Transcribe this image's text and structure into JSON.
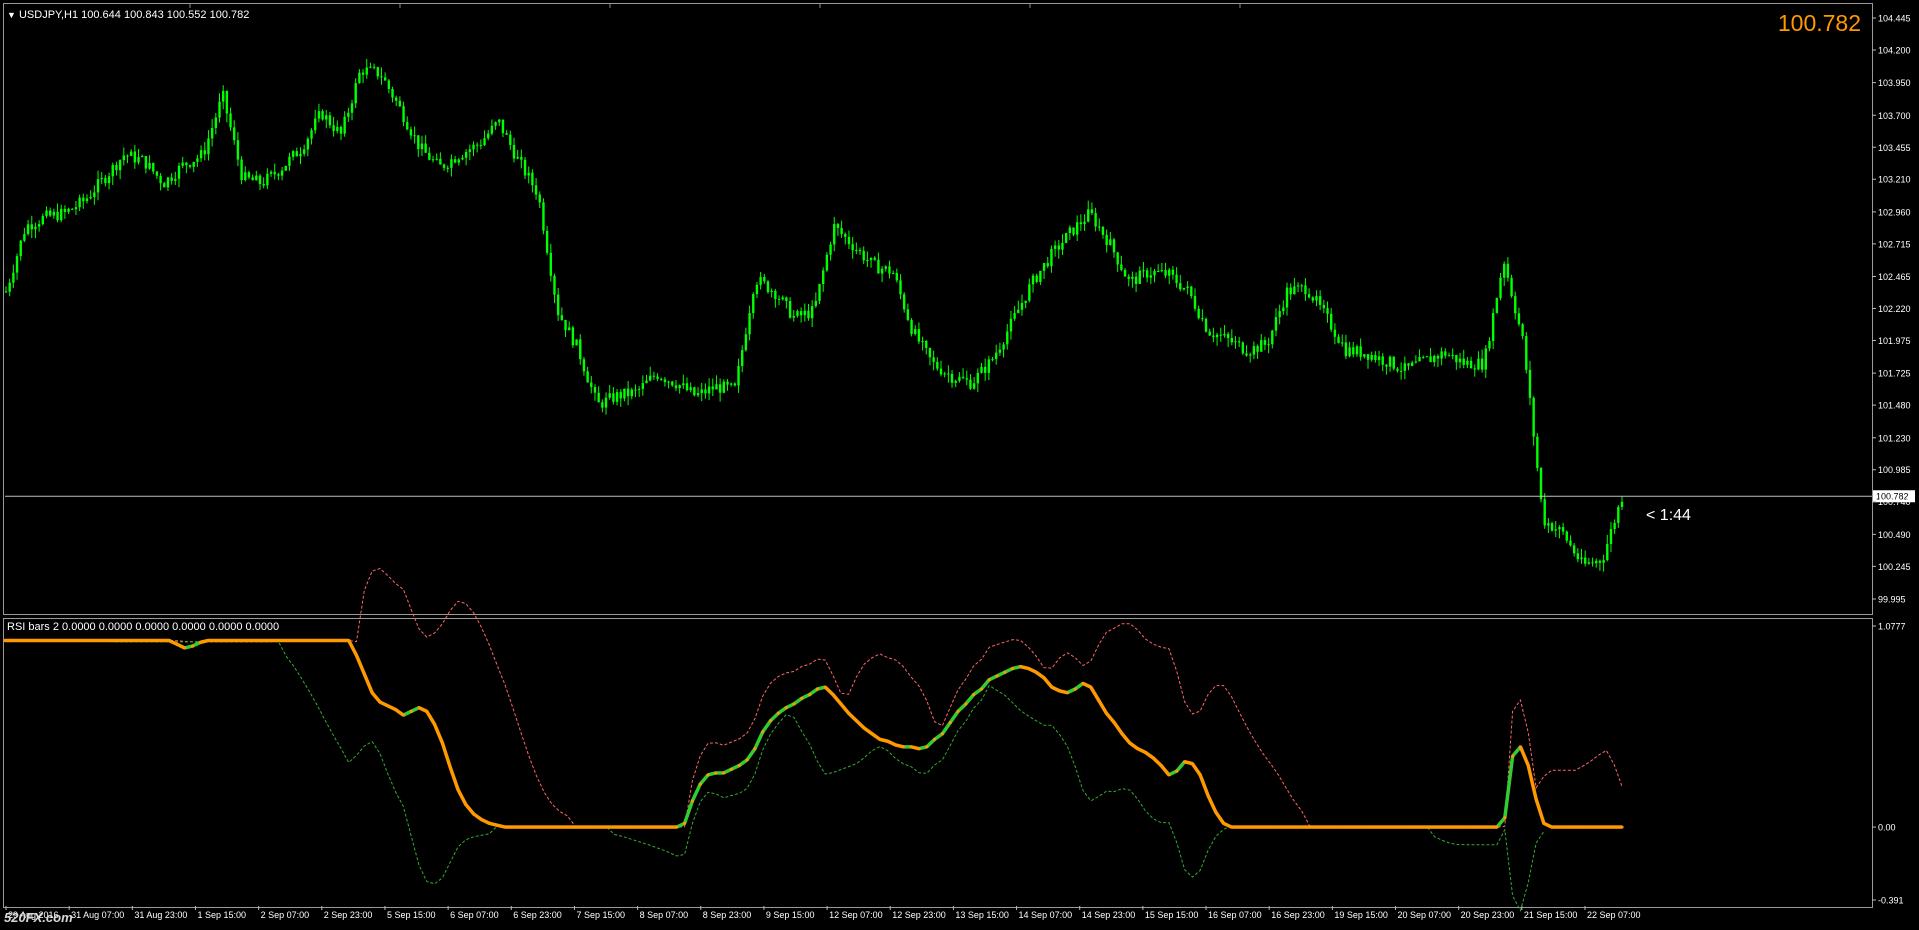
{
  "header": {
    "symbol_info": "USDJPY,H1  100.644 100.843 100.552 100.782",
    "indicator_info": "RSI bars 2 0.0000 0.0000 0.0000 0.0000 0.0000 0.0000",
    "current_price": "100.782",
    "countdown": "< 1:44",
    "watermark": "520FX.com"
  },
  "colors": {
    "background": "#000000",
    "bull_candle": "#00ff00",
    "price_line": "#c0c0c0",
    "current_price_text": "#ff9900",
    "rsi_up": "#33cc33",
    "rsi_down": "#ff9900",
    "band_upper": "#ff6666",
    "band_lower": "#33aa33"
  },
  "chart_data": [
    {
      "type": "candlestick",
      "title": "USDJPY,H1",
      "ylim": [
        99.995,
        104.445
      ],
      "y_ticks": [
        "104.445",
        "104.200",
        "103.950",
        "103.700",
        "103.455",
        "103.210",
        "102.960",
        "102.715",
        "102.465",
        "102.220",
        "101.975",
        "101.725",
        "101.480",
        "101.230",
        "100.985",
        "100.740",
        "100.490",
        "100.245",
        "99.995"
      ],
      "current_price": 100.782,
      "x_ticks": [
        "29 Aug 2016",
        "31 Aug 07:00",
        "31 Aug 23:00",
        "1 Sep 15:00",
        "2 Sep 07:00",
        "2 Sep 23:00",
        "5 Sep 15:00",
        "6 Sep 07:00",
        "6 Sep 23:00",
        "7 Sep 15:00",
        "8 Sep 07:00",
        "8 Sep 23:00",
        "9 Sep 15:00",
        "12 Sep 07:00",
        "12 Sep 23:00",
        "13 Sep 15:00",
        "14 Sep 07:00",
        "14 Sep 23:00",
        "15 Sep 15:00",
        "16 Sep 07:00",
        "16 Sep 23:00",
        "19 Sep 15:00",
        "20 Sep 07:00",
        "20 Sep 23:00",
        "21 Sep 15:00",
        "22 Sep 07:00"
      ],
      "close_path": [
        102.35,
        102.85,
        102.92,
        102.95,
        103.05,
        103.22,
        103.4,
        103.35,
        103.18,
        103.32,
        103.4,
        103.85,
        103.22,
        103.18,
        103.3,
        103.45,
        103.72,
        103.55,
        104.05,
        104.02,
        103.75,
        103.45,
        103.3,
        103.4,
        103.48,
        103.65,
        103.35,
        103.1,
        102.2,
        101.92,
        101.48,
        101.55,
        101.58,
        101.72,
        101.65,
        101.55,
        101.62,
        101.6,
        102.45,
        102.35,
        102.15,
        102.2,
        102.85,
        102.7,
        102.55,
        102.5,
        102.05,
        101.8,
        101.7,
        101.65,
        101.82,
        102.1,
        102.4,
        102.62,
        102.8,
        102.95,
        102.72,
        102.42,
        102.5,
        102.48,
        102.35,
        102.05,
        101.98,
        101.9,
        101.95,
        102.35,
        102.38,
        102.15,
        101.9,
        101.88,
        101.82,
        101.75,
        101.82,
        101.88,
        101.8,
        101.8,
        102.6,
        101.95,
        100.6,
        100.5,
        100.25,
        100.3,
        100.78
      ],
      "path_count": 83
    },
    {
      "type": "line",
      "title": "RSI bars 2",
      "ylim": [
        -0.391,
        1.0777
      ],
      "y_ticks": [
        "1.0777",
        "0.00",
        "-0.391"
      ],
      "series": [
        {
          "name": "rsi",
          "values": [
            1.0,
            1.0,
            1.0,
            1.0,
            1.0,
            1.0,
            1.0,
            1.0,
            1.0,
            1.0,
            1.0,
            1.0,
            1.0,
            1.0,
            1.0,
            1.0,
            1.0,
            1.0,
            1.0,
            1.0,
            1.0,
            1.0,
            0.98,
            0.96,
            0.97,
            0.99,
            1.0,
            1.0,
            1.0,
            1.0,
            1.0,
            1.0,
            1.0,
            1.0,
            1.0,
            1.0,
            1.0,
            1.0,
            1.0,
            1.0,
            1.0,
            1.0,
            1.0,
            1.0,
            1.0,
            0.92,
            0.82,
            0.72,
            0.67,
            0.65,
            0.63,
            0.6,
            0.62,
            0.64,
            0.62,
            0.55,
            0.45,
            0.32,
            0.2,
            0.12,
            0.07,
            0.04,
            0.02,
            0.01,
            0.0,
            0.0,
            0.0,
            0.0,
            0.0,
            0.0,
            0.0,
            0.0,
            0.0,
            0.0,
            0.0,
            0.0,
            0.0,
            0.0,
            0.0,
            0.0,
            0.0,
            0.0,
            0.0,
            0.0,
            0.0,
            0.0,
            0.0,
            0.02,
            0.14,
            0.23,
            0.28,
            0.29,
            0.29,
            0.31,
            0.33,
            0.36,
            0.42,
            0.51,
            0.57,
            0.61,
            0.64,
            0.66,
            0.69,
            0.71,
            0.74,
            0.75,
            0.71,
            0.66,
            0.61,
            0.57,
            0.53,
            0.5,
            0.47,
            0.46,
            0.44,
            0.43,
            0.43,
            0.42,
            0.43,
            0.47,
            0.5,
            0.56,
            0.62,
            0.66,
            0.71,
            0.74,
            0.79,
            0.81,
            0.83,
            0.85,
            0.86,
            0.85,
            0.83,
            0.8,
            0.75,
            0.73,
            0.72,
            0.74,
            0.77,
            0.75,
            0.68,
            0.61,
            0.56,
            0.5,
            0.45,
            0.42,
            0.4,
            0.37,
            0.33,
            0.28,
            0.3,
            0.35,
            0.34,
            0.28,
            0.17,
            0.08,
            0.02,
            0.0,
            0.0,
            0.0,
            0.0,
            0.0,
            0.0,
            0.0,
            0.0,
            0.0,
            0.0,
            0.0,
            0.0,
            0.0,
            0.0,
            0.0,
            0.0,
            0.0,
            0.0,
            0.0,
            0.0,
            0.0,
            0.0,
            0.0,
            0.0,
            0.0,
            0.0,
            0.0,
            0.0,
            0.0,
            0.0,
            0.0,
            0.0,
            0.0,
            0.0,
            0.0,
            0.05,
            0.38,
            0.43,
            0.33,
            0.15,
            0.02,
            0.0,
            0.0,
            0.0,
            0.0,
            0.0,
            0.0,
            0.0,
            0.0,
            0.0,
            0.0
          ]
        }
      ]
    }
  ]
}
